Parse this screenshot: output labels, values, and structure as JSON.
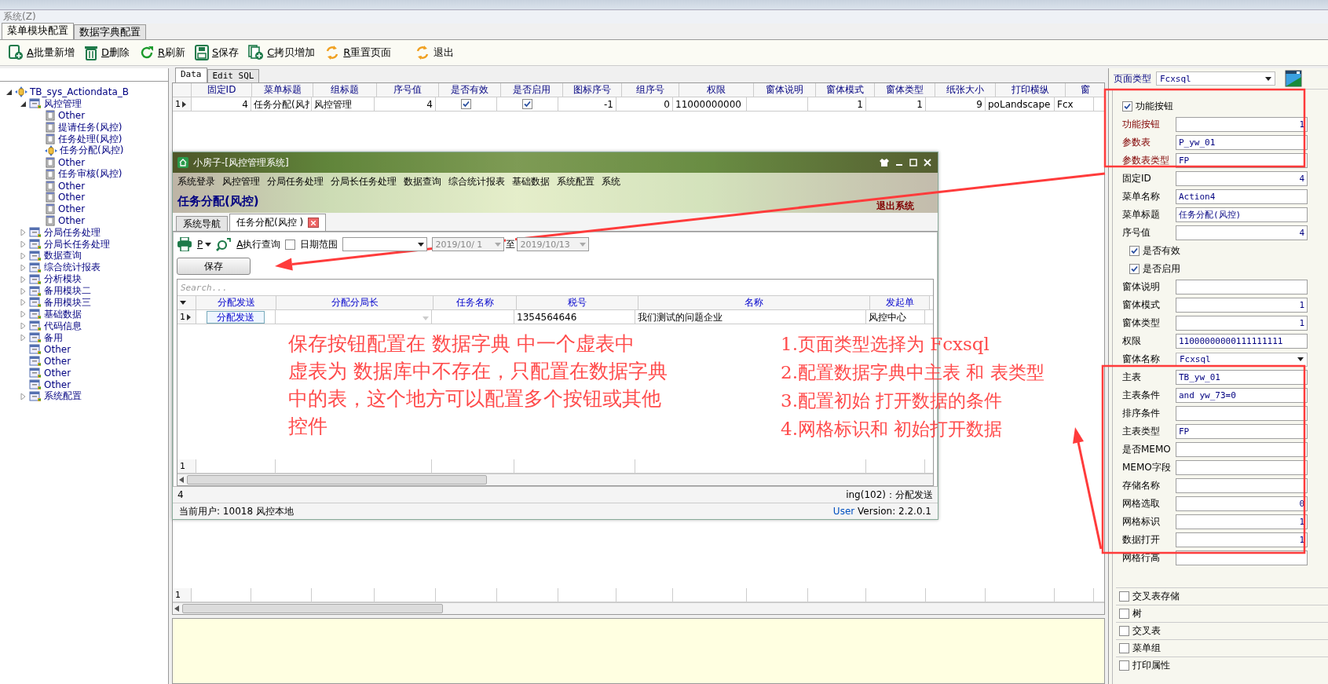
{
  "menu_bar": [
    {
      "label": "系统(Z)"
    }
  ],
  "main_tabs": [
    {
      "label": "菜单模块配置",
      "selected": true
    },
    {
      "label": "数据字典配置",
      "selected": false
    }
  ],
  "toolbar": [
    {
      "hotkey": "A",
      "label": "批量新增"
    },
    {
      "hotkey": "D",
      "label": "删除"
    },
    {
      "hotkey": "R",
      "label": "刷新"
    },
    {
      "hotkey": "S",
      "label": "保存"
    },
    {
      "hotkey": "C",
      "label": "拷贝增加"
    },
    {
      "hotkey": "R",
      "label": "重置页面"
    },
    {
      "label": "退出"
    }
  ],
  "tree": {
    "label": "TB_sys_Actiondata_B",
    "kind": "root",
    "expanded": true,
    "children": [
      {
        "label": "风控管理",
        "kind": "group",
        "expanded": true,
        "children": [
          {
            "label": "Other",
            "kind": "page"
          },
          {
            "label": "提请任务(风控)",
            "kind": "page"
          },
          {
            "label": "任务处理(风控)",
            "kind": "page"
          },
          {
            "label": "任务分配(风控)",
            "kind": "action"
          },
          {
            "label": "Other",
            "kind": "page"
          },
          {
            "label": "任务审核(风控)",
            "kind": "page"
          },
          {
            "label": "Other",
            "kind": "page"
          },
          {
            "label": "Other",
            "kind": "page"
          },
          {
            "label": "Other",
            "kind": "page"
          },
          {
            "label": "Other",
            "kind": "page"
          }
        ]
      },
      {
        "label": "分局任务处理",
        "kind": "group",
        "expanded": false
      },
      {
        "label": "分局长任务处理",
        "kind": "group",
        "expanded": false
      },
      {
        "label": "数据查询",
        "kind": "group",
        "expanded": false
      },
      {
        "label": "综合统计报表",
        "kind": "group",
        "expanded": false
      },
      {
        "label": "分析模块",
        "kind": "group",
        "expanded": false
      },
      {
        "label": "备用模块二",
        "kind": "group",
        "expanded": false
      },
      {
        "label": "备用模块三",
        "kind": "group",
        "expanded": false
      },
      {
        "label": "基础数据",
        "kind": "group",
        "expanded": false
      },
      {
        "label": "代码信息",
        "kind": "group",
        "expanded": false
      },
      {
        "label": "备用",
        "kind": "group",
        "expanded": false
      },
      {
        "label": "Other",
        "kind": "leaf"
      },
      {
        "label": "Other",
        "kind": "leaf"
      },
      {
        "label": "Other",
        "kind": "leaf"
      },
      {
        "label": "Other",
        "kind": "leaf"
      },
      {
        "label": "系统配置",
        "kind": "group",
        "expanded": false
      }
    ]
  },
  "grid_tabs": [
    {
      "label": "Data",
      "selected": true
    },
    {
      "label": "Edit SQL",
      "selected": false
    }
  ],
  "grid": {
    "columns": [
      {
        "label": "固定ID",
        "kind": "number"
      },
      {
        "label": "菜单标题",
        "kind": "text"
      },
      {
        "label": "组标题",
        "kind": "text"
      },
      {
        "label": "序号值",
        "kind": "number"
      },
      {
        "label": "是否有效",
        "kind": "check"
      },
      {
        "label": "是否启用",
        "kind": "check"
      },
      {
        "label": "图标序号",
        "kind": "number"
      },
      {
        "label": "组序号",
        "kind": "number"
      },
      {
        "label": "权限",
        "kind": "text"
      },
      {
        "label": "窗体说明",
        "kind": "text"
      },
      {
        "label": "窗体模式",
        "kind": "number"
      },
      {
        "label": "窗体类型",
        "kind": "number"
      },
      {
        "label": "纸张大小",
        "kind": "number"
      },
      {
        "label": "打印横纵",
        "kind": "text"
      },
      {
        "label": "窗",
        "kind": "text"
      }
    ],
    "rows": [
      {
        "number": "1",
        "selected": true,
        "cells": [
          {
            "text": "4"
          },
          {
            "text": "任务分配(风扌"
          },
          {
            "text": "风控管理"
          },
          {
            "text": "4"
          },
          {
            "checked": true
          },
          {
            "checked": true
          },
          {
            "text": "-1"
          },
          {
            "text": "0"
          },
          {
            "text": "11000000000"
          },
          {},
          {
            "text": "1"
          },
          {
            "text": "1"
          },
          {
            "text": "9"
          },
          {
            "text": "poLandscape"
          },
          {
            "text": "Fcx"
          }
        ]
      }
    ],
    "footer_number": "1"
  },
  "app_window": {
    "title": "小房子-[风控管理系统]",
    "menu": [
      "系统登录",
      "风控管理",
      "分局任务处理",
      "分局长任务处理",
      "数据查询",
      "综合统计报表",
      "基础数据",
      "系统配置",
      "系统"
    ],
    "page_title": "任务分配(风控)",
    "exit_link": "退出系统",
    "tabs": [
      {
        "label": "系统导航",
        "selected": false
      },
      {
        "label": "任务分配(风控 )",
        "selected": true
      }
    ],
    "print_label": "P",
    "query_hotkey": "A",
    "query_label": "执行查询",
    "date_range": {
      "label": "日期范围",
      "checked": false
    },
    "date_from": {
      "value": "2019/10/ 1",
      "disabled": true
    },
    "to_label": "至",
    "date_to": {
      "value": "2019/10/13",
      "disabled": true
    },
    "save_button": "保存",
    "search_placeholder": "Search...",
    "grid": {
      "columns": [
        {
          "label": "分配发送",
          "kind": "button"
        },
        {
          "label": "分配分局长",
          "kind": "combo"
        },
        {
          "label": "任务名称",
          "kind": "text"
        },
        {
          "label": "税号",
          "kind": "text"
        },
        {
          "label": "名称",
          "kind": "text"
        },
        {
          "label": "发起单",
          "kind": "text"
        }
      ],
      "rows": [
        {
          "number": "1",
          "selected": true,
          "cells": [
            "分配发送",
            null,
            null,
            "1354564646",
            "我们测试的问题企业",
            "风控中心"
          ]
        }
      ],
      "footer_number": "1"
    },
    "record_count": "4",
    "grid_status": "ing(102)：分配发送",
    "user_status": "当前用户: 10018 风控本地",
    "user_label": "User",
    "version": "Version: 2.2.0.1"
  },
  "properties": {
    "page_type": {
      "label": "页面类型",
      "value": "Fcxsql"
    },
    "function_group": {
      "label": "功能按钮",
      "checked": true,
      "fields": [
        {
          "label": "功能按钮",
          "value": "1",
          "kind": "number"
        },
        {
          "label": "参数表",
          "value": "P_yw_01",
          "kind": "text"
        },
        {
          "label": "参数表类型",
          "value": "FP",
          "kind": "text"
        }
      ]
    },
    "fields": [
      {
        "label": "固定ID",
        "value": "4",
        "kind": "number"
      },
      {
        "label": "菜单名称",
        "value": "Action4",
        "kind": "text"
      },
      {
        "label": "菜单标题",
        "value": "任务分配(风控)",
        "kind": "text"
      },
      {
        "label": "序号值",
        "value": "4",
        "kind": "number"
      },
      {
        "label": "是否有效",
        "kind": "check",
        "checked": true
      },
      {
        "label": "是否启用",
        "kind": "check",
        "checked": true
      },
      {
        "label": "窗体说明",
        "kind": "text"
      },
      {
        "label": "窗体模式",
        "value": "1",
        "kind": "number"
      },
      {
        "label": "窗体类型",
        "value": "1",
        "kind": "number"
      },
      {
        "label": "权限",
        "value": "11000000000111111111",
        "kind": "text"
      },
      {
        "label": "窗体名称",
        "value": "Fcxsql",
        "kind": "select"
      },
      {
        "label": "主表",
        "value": "TB_yw_01",
        "kind": "text"
      },
      {
        "label": "主表条件",
        "value": "and yw_73=0",
        "kind": "text"
      },
      {
        "label": "排序条件",
        "kind": "text"
      },
      {
        "label": "主表类型",
        "value": "FP",
        "kind": "text"
      },
      {
        "label": "是否MEMO",
        "kind": "text"
      },
      {
        "label": "MEMO字段",
        "kind": "text"
      },
      {
        "label": "存储名称",
        "kind": "text"
      },
      {
        "label": "网格选取",
        "value": "0",
        "kind": "number"
      },
      {
        "label": "网格标识",
        "value": "1",
        "kind": "number"
      },
      {
        "label": "数据打开",
        "value": "1",
        "kind": "number"
      },
      {
        "label": "网格行高",
        "kind": "text"
      }
    ],
    "options": [
      {
        "label": "交叉表存储",
        "checked": false
      },
      {
        "label": "树",
        "checked": false
      },
      {
        "label": "交叉表",
        "checked": false
      },
      {
        "label": "菜单组",
        "checked": false
      },
      {
        "label": "打印属性",
        "checked": false
      }
    ]
  },
  "annotations": [
    {
      "lines": [
        "保存按钮配置在 数据字典 中一个虚表中",
        "虚表为 数据库中不存在，只配置在数据字典",
        "中的表，这个地方可以配置多个按钮或其他",
        "控件"
      ]
    },
    {
      "lines": [
        "1.页面类型选择为 Fcxsql",
        "2.配置数据字典中主表 和 表类型",
        "3.配置初始 打开数据的条件",
        "4.网格标识和 初始打开数据"
      ]
    }
  ]
}
